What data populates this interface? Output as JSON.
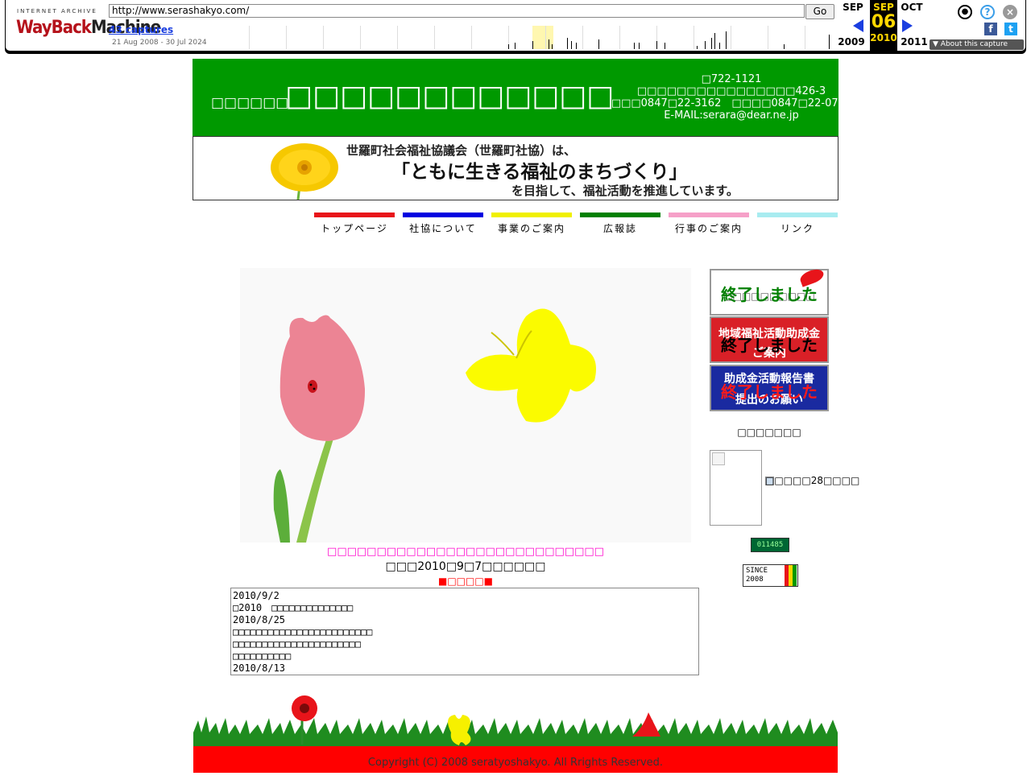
{
  "wayback": {
    "logo_small": "INTERNET ARCHIVE",
    "logo_way": "WayBack",
    "logo_machine": "Machine",
    "url": "http://www.serashakyo.com/",
    "go_label": "Go",
    "captures": "43 captures",
    "range": "21 Aug 2008 - 30 Jul 2024",
    "prev_month": "SEP",
    "prev_year": "2009",
    "cur_month": "SEP",
    "cur_day": "06",
    "cur_year": "2010",
    "next_month": "OCT",
    "next_year": "2011",
    "about": "▼ About this capture",
    "icons": [
      "user-icon",
      "help-icon",
      "close-icon",
      "facebook-icon",
      "twitter-icon"
    ]
  },
  "header": {
    "sub": "□□□□□□",
    "title": "□□□□□□□□□□□□",
    "postal": "□722-1121",
    "address": "□□□□□□□□□□□□□□□□426-3",
    "phone_fax": "□□□0847□22-3162　□□□□0847□22-0752",
    "email": "E-MAIL:serara@dear.ne.jp",
    "bg_color": "#009900"
  },
  "banner": {
    "line1": "世羅町社会福祉協議会（世羅町社協）は、",
    "line2": "「ともに生きる福祉のまちづくり」",
    "line3": "を目指して、福祉活動を推進しています。"
  },
  "nav": [
    {
      "label": "トップページ",
      "color": "#e8141a"
    },
    {
      "label": "社協について",
      "color": "#0000e0"
    },
    {
      "label": "事業のご案内",
      "color": "#f0f000"
    },
    {
      "label": "広報誌",
      "color": "#008000"
    },
    {
      "label": "行事のご案内",
      "color": "#f6a0c8"
    },
    {
      "label": "リンク",
      "color": "#a8ecf0"
    }
  ],
  "news": {
    "pink": "□□□□□□□□□□□□□□□□□□□□□□□□□□□□",
    "updated": "□□□2010□9□7□□□□□□",
    "label": "■□□□□■",
    "text": "2010/9/2\n□2010　□□□□□□□□□□□□□□\n2010/8/25\n□□□□□□□□□□□□□□□□□□□□□□□□\n□□□□□□□□□□□□□□□□□□□□□□\n□□□□□□□□□□\n2010/8/13"
  },
  "right": {
    "btn1_main": "□□□□□□□□□□",
    "btn1_done": "終了しました",
    "btn2_main_1": "地域福祉活動助成金",
    "btn2_main_2": "ご案内",
    "btn2_done": "終了しました",
    "btn3_main_1": "助成金活動報告書",
    "btn3_main_2": "提出のお願い",
    "btn3_done": "終了しました",
    "label": "□□□□□□□",
    "img_text": "□□□□□28□□□□",
    "counter": "011485",
    "since": "SINCE 2008"
  },
  "footer": {
    "copyright": "Copyright (C) 2008 seratyoshakyo. All Rrights Reserved.",
    "bg_color": "#ff0000"
  }
}
